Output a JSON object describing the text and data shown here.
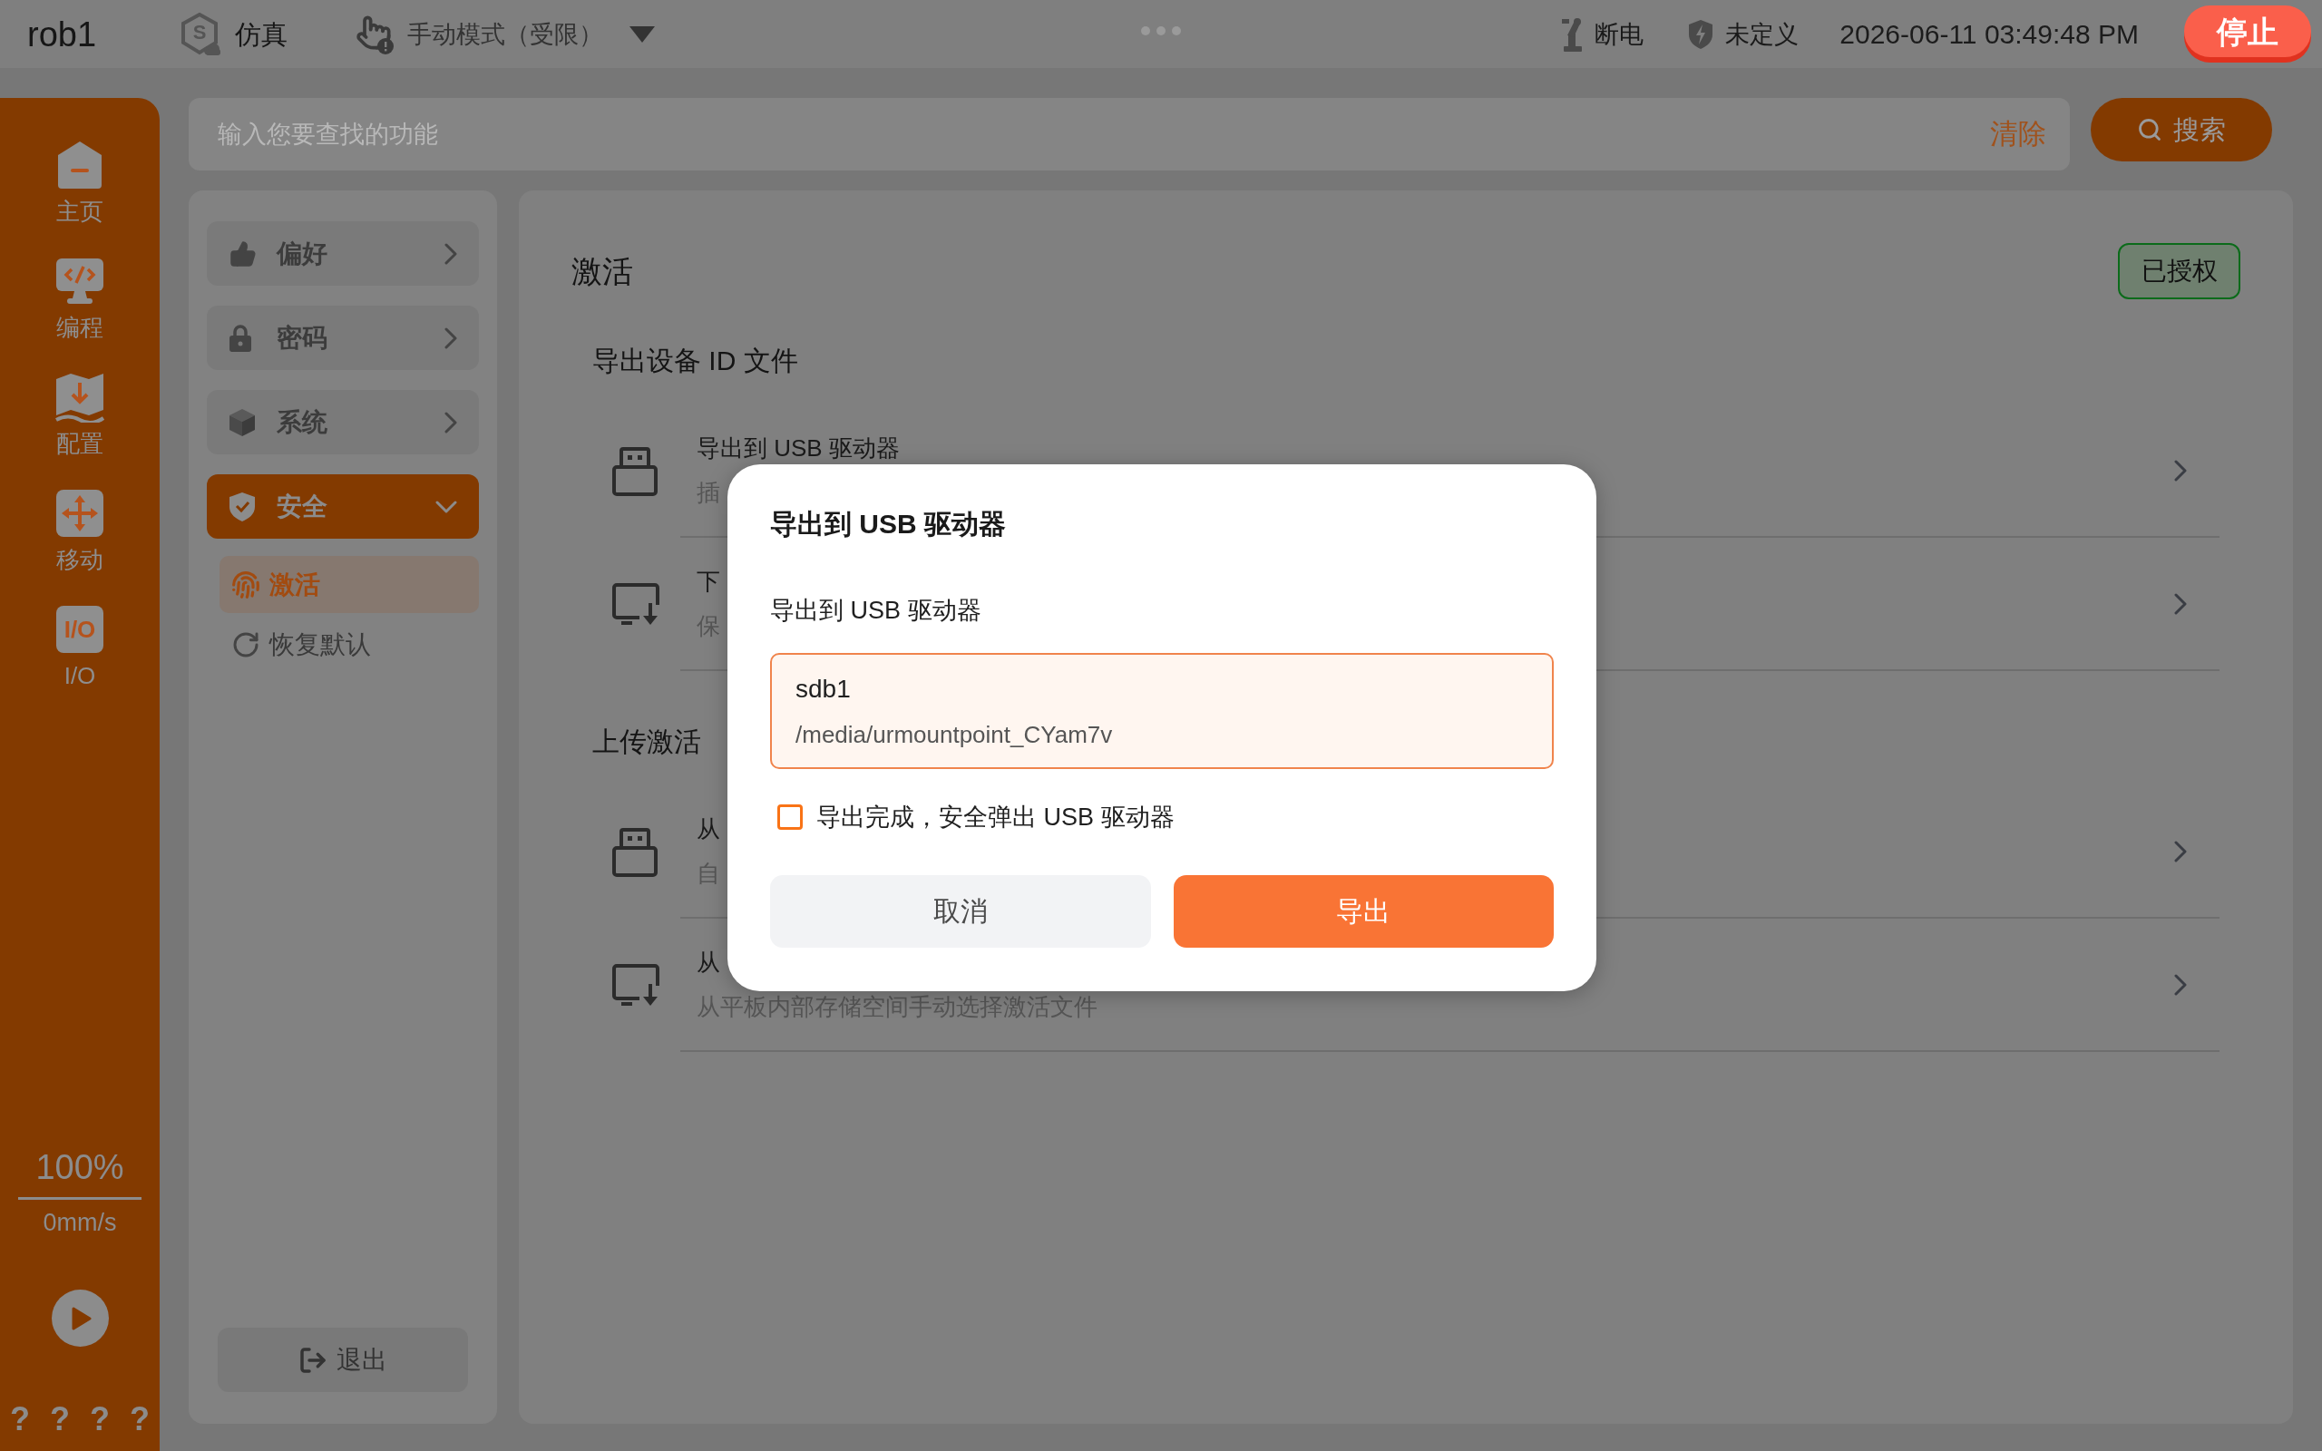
{
  "top_bar": {
    "robot_name": "rob1",
    "mode": {
      "badge": "S",
      "label": "仿真"
    },
    "control_mode": "手动模式（受限）",
    "power_status": "断电",
    "safety_status": "未定义",
    "datetime": "2026-06-11 03:49:48 PM",
    "stop_button": "停止"
  },
  "nav_rail": {
    "items": [
      {
        "label": "主页"
      },
      {
        "label": "编程"
      },
      {
        "label": "配置"
      },
      {
        "label": "移动"
      },
      {
        "label": "I/O",
        "icon_text": "I/O"
      }
    ],
    "speed": "100%",
    "velocity": "0mm/s",
    "status_marks": [
      "?",
      "?",
      "?",
      "?"
    ]
  },
  "search": {
    "placeholder": "输入您要查找的功能",
    "clear": "清除",
    "button": "搜索"
  },
  "settings_nav": {
    "items": [
      {
        "label": "偏好",
        "selected": false,
        "expanded": false
      },
      {
        "label": "密码",
        "selected": false,
        "expanded": false
      },
      {
        "label": "系统",
        "selected": false,
        "expanded": false
      },
      {
        "label": "安全",
        "selected": true,
        "expanded": true,
        "children": [
          {
            "label": "激活",
            "selected": true
          },
          {
            "label": "恢复默认",
            "selected": false
          }
        ]
      }
    ],
    "logout": "退出"
  },
  "content": {
    "title": "激活",
    "license_status": "已授权",
    "sections": [
      {
        "heading": "导出设备 ID 文件",
        "rows": [
          {
            "title": "导出到 USB 驱动器",
            "subtitle": "插"
          },
          {
            "title": "下",
            "subtitle": "保"
          }
        ]
      },
      {
        "heading": "上传激活",
        "rows": [
          {
            "title": "从",
            "subtitle": "自"
          },
          {
            "title": "从",
            "subtitle": "从平板内部存储空间手动选择激活文件"
          }
        ]
      }
    ]
  },
  "dialog": {
    "title": "导出到 USB 驱动器",
    "label": "导出到 USB 驱动器",
    "devices": [
      {
        "name": "sdb1",
        "path": "/media/urmountpoint_CYam7v",
        "selected": true
      }
    ],
    "eject_option": {
      "label": "导出完成，安全弹出 USB 驱动器",
      "checked": false
    },
    "buttons": [
      {
        "label": "取消",
        "kind": "secondary"
      },
      {
        "label": "导出",
        "kind": "primary"
      }
    ]
  }
}
